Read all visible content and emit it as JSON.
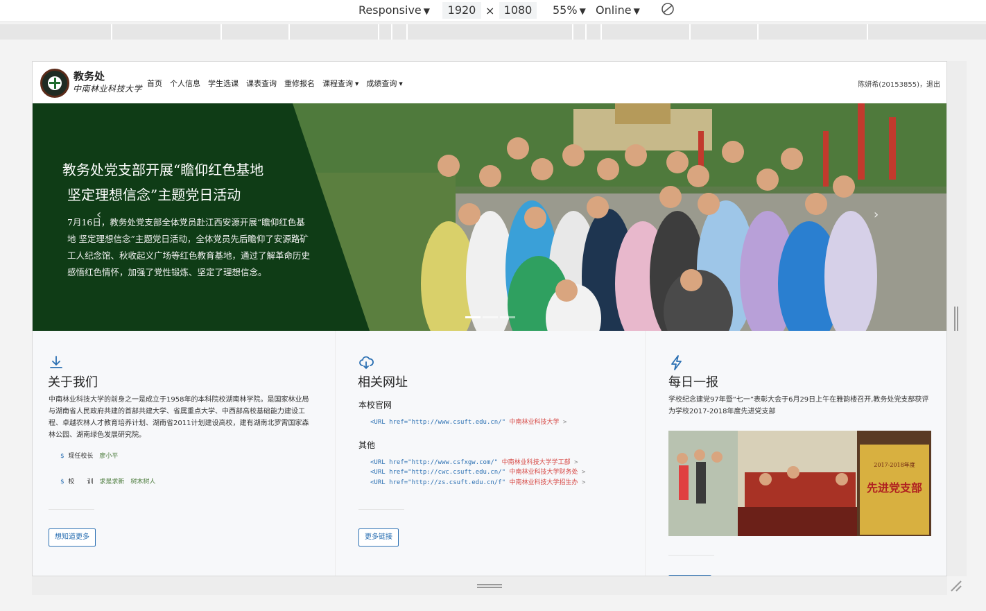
{
  "devtools": {
    "device": "Responsive",
    "width": "1920",
    "times": "×",
    "height": "1080",
    "zoom": "55%",
    "network": "Online",
    "arrow": "▼"
  },
  "site": {
    "brand_title": "教务处",
    "brand_sub": "中南林业科技大学",
    "nav": [
      {
        "label": "首页"
      },
      {
        "label": "个人信息"
      },
      {
        "label": "学生选课"
      },
      {
        "label": "课表查询"
      },
      {
        "label": "重修报名"
      },
      {
        "label": "课程查询",
        "caret": "▼"
      },
      {
        "label": "成绩查询",
        "caret": "▼"
      }
    ],
    "user_info": "陈妍希(20153855)，退出"
  },
  "banner": {
    "headline_1": "教务处党支部开展“瞻仰红色基地",
    "headline_2": "坚定理想信念”主题党日活动",
    "body": "7月16日，教务处党支部全体党员赴江西安源开展“瞻仰红色基地 坚定理想信念”主题党日活动，全体党员先后瞻仰了安源路矿工人纪念馆、秋收起义广场等红色教育基地，通过了解革命历史感悟红色情怀，加强了党性锻炼、坚定了理想信念。",
    "prev": "‹",
    "next": "›",
    "indicators": 3,
    "active_indicator": 0
  },
  "about": {
    "title": "关于我们",
    "text": "中南林业科技大学的前身之一是成立于1958年的本科院校湖南林学院。是国家林业局与湖南省人民政府共建的首部共建大学、省属重点大学、中西部高校基础能力建设工程、卓越农林人才教育培养计划、湖南省2011计划建设高校，建有湖南北罗霄国家森林公园、湖南绿色发展研究院。",
    "line1_prefix": "$",
    "line1_label": "现任校长",
    "line1_value": "廖小平",
    "line2_prefix": "$",
    "line2_label": "校　　训",
    "line2_value": "求是求新　树木树人",
    "button": "想知道更多"
  },
  "links": {
    "title": "相关网址",
    "official_head": "本校官网",
    "official": [
      {
        "code": "<URL href=\"http://www.csuft.edu.cn/\"",
        "name": "中南林业科技大学",
        "tail": ">"
      }
    ],
    "other_head": "其他",
    "other": [
      {
        "code": "<URL href=\"http://www.csfxgw.com/\"",
        "name": "中南林业科技大学学工部",
        "tail": ">"
      },
      {
        "code": "<URL href=\"http://cwc.csuft.edu.cn/\"",
        "name": "中南林业科技大学财务处",
        "tail": ">"
      },
      {
        "code": "<URL href=\"http://zs.csuft.edu.cn/f\"",
        "name": "中南林业科技大学招生办",
        "tail": ">"
      }
    ],
    "button": "更多链接"
  },
  "daily": {
    "title": "每日一报",
    "text": "学校纪念建党97年暨“七一”表彰大会于6月29日上午在雅韵楼召开,教务处党支部获评为学校2017-2018年度先进党支部",
    "plaque_year": "2017-2018年度",
    "plaque_text": "先进党支部"
  },
  "colors": {
    "accent": "#2a6fb2",
    "banner_green": "#0f3c16",
    "link_red": "#d64541"
  }
}
